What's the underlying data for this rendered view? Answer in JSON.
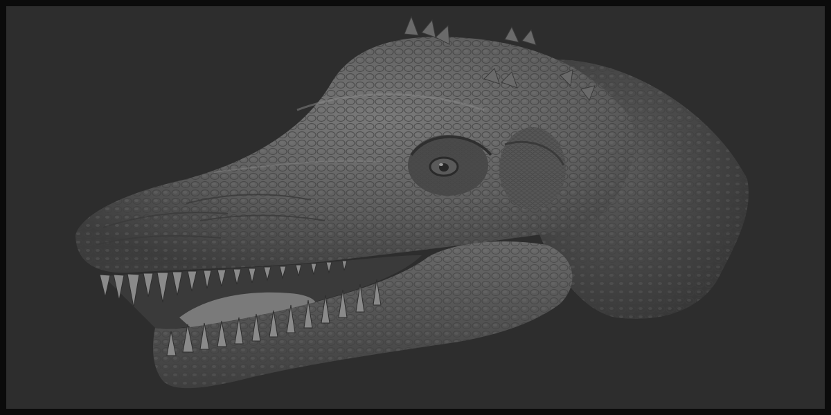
{
  "scene": {
    "subject": "sculpted-reptile-head",
    "background_color": "#2d2d2d",
    "frame_color": "#0b0b0b",
    "material_color": "#6e6e6e"
  }
}
